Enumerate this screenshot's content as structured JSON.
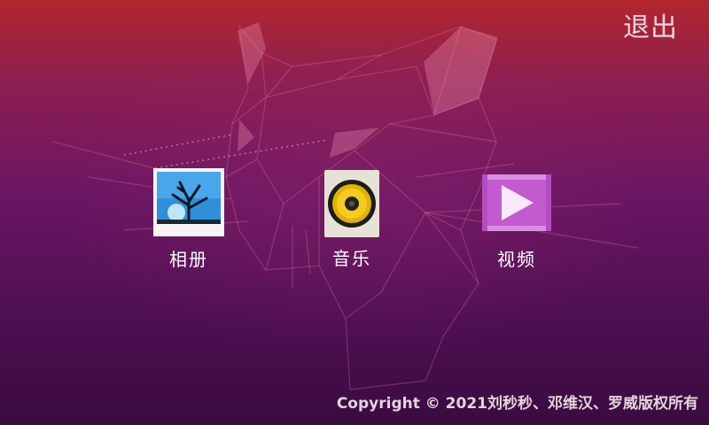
{
  "header": {
    "exit_label": "退出"
  },
  "apps": [
    {
      "label": "相册",
      "icon": "gallery-icon"
    },
    {
      "label": "音乐",
      "icon": "speaker-icon"
    },
    {
      "label": "视频",
      "icon": "play-icon"
    }
  ],
  "footer": {
    "copyright": "Copyright © 2021刘秒秒、邓维汉、罗威版权所有"
  },
  "colors": {
    "background_top": "#b2262e",
    "background_bottom": "#3a0b40",
    "video_icon": "#c35ad0",
    "music_icon_bg": "#e8e2d6",
    "gallery_icon_sky": "#2f8fd8"
  }
}
